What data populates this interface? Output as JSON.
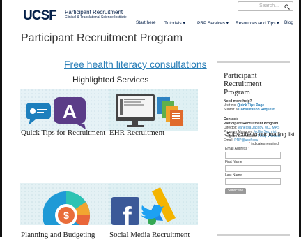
{
  "header": {
    "logo": "UCSF",
    "logo_line1": "Participant Recruitment",
    "logo_line2": "Clinical & Translational Science Institute",
    "search_placeholder": "Search...",
    "nav": [
      "Start here",
      "Tutorials ▾",
      "PRP Services ▾",
      "Resources and Tips ▾",
      "Blog"
    ]
  },
  "page": {
    "title": "Participant Recruitment Program",
    "top_link": "Free health literacy consultations",
    "highlighted": "Highlighted Services",
    "tiles": [
      {
        "label": "Quick Tips for Recruitment",
        "icon": "chat-bubbles-icon"
      },
      {
        "label": "EHR Recruitment",
        "icon": "monitor-documents-icon"
      },
      {
        "label": "Planning and Budgeting",
        "icon": "donut-chart-icon"
      },
      {
        "label": "Social Media Recruitment",
        "icon": "social-logos-icon"
      }
    ]
  },
  "sidebar": {
    "title": "Participant Recruitment Program",
    "need_help": "Need more help?",
    "visit_prefix": "Visit our ",
    "quick_tips_link": "Quick Tips Page",
    "submit_prefix": "Submit a ",
    "consult_link": "Consultation Request",
    "contact_label": "Contact:",
    "contact_org": "Participant Recruitment Program",
    "director_prefix": "Director: ",
    "director": "Vanessa Jacoby, MD, MAS",
    "manager_prefix": "Program Manager: ",
    "manager": "Mollie Sechrist",
    "coordinator_prefix": "Program Coordinator: ",
    "coordinator": "Ricky Warnock",
    "email_prefix": "Email: ",
    "email": "PRP@ucsf.edu",
    "subscribe_title": "Subscribe to our mailing list",
    "required_note": "indicates required",
    "email_label": "Email Address",
    "first_name_label": "First Name",
    "last_name_label": "Last Name",
    "subscribe_button": "Subscribe"
  }
}
